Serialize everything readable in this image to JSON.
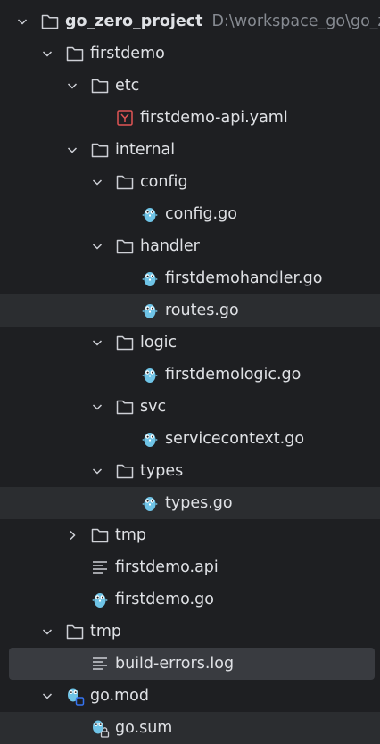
{
  "project": {
    "name": "go_zero_project",
    "path": "D:\\workspace_go\\go_ze"
  },
  "nodes": [
    {
      "label": "firstdemo"
    },
    {
      "label": "etc"
    },
    {
      "label": "firstdemo-api.yaml"
    },
    {
      "label": "internal"
    },
    {
      "label": "config"
    },
    {
      "label": "config.go"
    },
    {
      "label": "handler"
    },
    {
      "label": "firstdemohandler.go"
    },
    {
      "label": "routes.go"
    },
    {
      "label": "logic"
    },
    {
      "label": "firstdemologic.go"
    },
    {
      "label": "svc"
    },
    {
      "label": "servicecontext.go"
    },
    {
      "label": "types"
    },
    {
      "label": "types.go"
    },
    {
      "label": "tmp"
    },
    {
      "label": "firstdemo.api"
    },
    {
      "label": "firstdemo.go"
    },
    {
      "label": "tmp"
    },
    {
      "label": "build-errors.log"
    },
    {
      "label": "go.mod"
    },
    {
      "label": "go.sum"
    }
  ],
  "colors": {
    "background": "#1e1f22",
    "hover_row": "#2b2d30",
    "selected_row": "#393b40",
    "text": "#dfe1e5",
    "path_text": "#868a91",
    "gopher": "#6fc4e7",
    "yaml_icon": "#e05555"
  }
}
